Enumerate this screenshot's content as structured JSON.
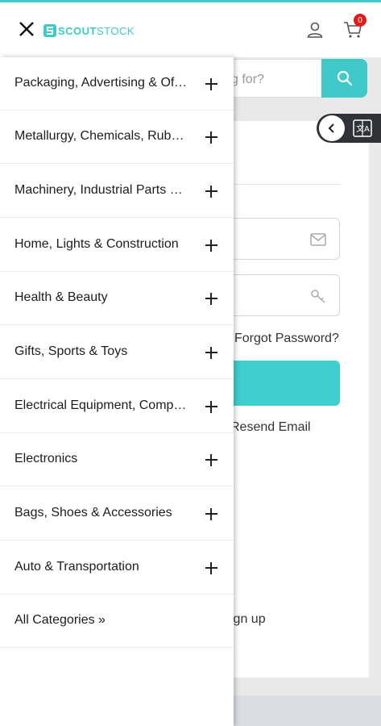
{
  "header": {
    "logo_text_a": "SCOUT",
    "logo_text_b": "STOCK",
    "cart_count": "0"
  },
  "search": {
    "placeholder_visible": "g for?"
  },
  "login": {
    "forgot_password": "Forgot Password?",
    "resend_email": "Resend Email",
    "signup": "ign up"
  },
  "drawer": {
    "categories": [
      "Packaging, Advertising & Office",
      "Metallurgy, Chemicals, Rubber",
      "Machinery, Industrial Parts & Tools",
      "Home, Lights & Construction",
      "Health & Beauty",
      "Gifts, Sports & Toys",
      "Electrical Equipment, Components",
      "Electronics",
      "Bags, Shoes & Accessories",
      "Auto & Transportation"
    ],
    "all_categories": "All Categories »"
  },
  "colors": {
    "accent": "#3fc9c9",
    "badge": "#e21b1b",
    "widget": "#2f3338"
  },
  "icons": [
    "close-icon",
    "user-icon",
    "cart-icon",
    "search-icon",
    "email-icon",
    "key-icon",
    "chevron-left-icon",
    "translate-icon",
    "plus-icon"
  ]
}
